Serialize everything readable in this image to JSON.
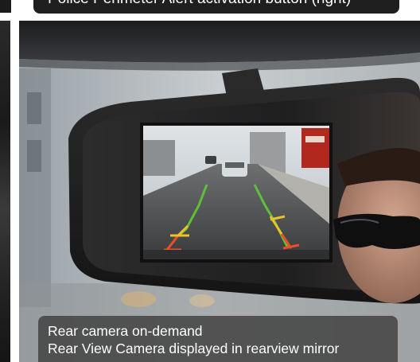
{
  "top_caption": {
    "text": "Police Perimeter Alert activation button (right)"
  },
  "caption": {
    "line1": "Rear camera on-demand",
    "line2": "Rear View Camera displayed in rearview mirror"
  }
}
